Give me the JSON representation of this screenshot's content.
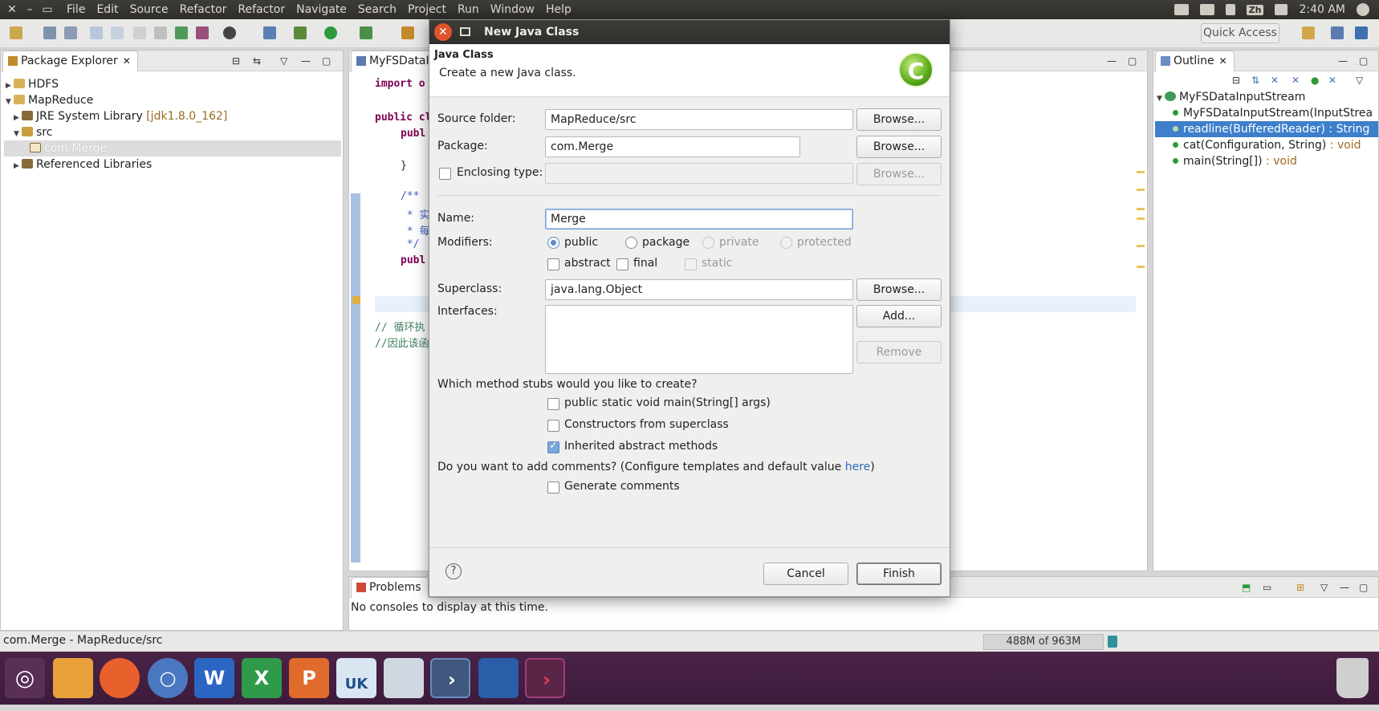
{
  "menubar": {
    "items": [
      "File",
      "Edit",
      "Source",
      "Refactor",
      "Refactor",
      "Navigate",
      "Search",
      "Project",
      "Run",
      "Window",
      "Help"
    ],
    "time": "2:40 AM",
    "input_method": "Zh"
  },
  "toolbar": {
    "quick_access": "Quick Access"
  },
  "package_explorer": {
    "tab": "Package Explorer",
    "tree": [
      {
        "label": "HDFS",
        "decoration": ""
      },
      {
        "label": "MapReduce",
        "decoration": ""
      },
      {
        "label": "JRE System Library",
        "decoration": "[jdk1.8.0_162]"
      },
      {
        "label": "src",
        "decoration": ""
      },
      {
        "label": "com.Merge",
        "decoration": ""
      },
      {
        "label": "Referenced Libraries",
        "decoration": ""
      }
    ]
  },
  "editor": {
    "tab": "MyFSDataI",
    "lines": [
      "import o",
      "public cl",
      "publ",
      "}",
      "/**",
      " * 实",
      " * 每",
      " */",
      "publ",
      "// 循环执",
      "//因此该函"
    ]
  },
  "outline": {
    "tab": "Outline",
    "items": [
      {
        "name": "MyFSDataInputStream",
        "ret": ""
      },
      {
        "name": "MyFSDataInputStream(InputStrea",
        "ret": ""
      },
      {
        "name": "readline(BufferedReader) : String",
        "ret": ""
      },
      {
        "name": "cat(Configuration, String)",
        "ret": " : void"
      },
      {
        "name": "main(String[])",
        "ret": " : void"
      }
    ]
  },
  "console": {
    "tab": "Problems",
    "message": "No consoles to display at this time."
  },
  "statusbar": {
    "left": "com.Merge - MapReduce/src",
    "heap": "488M of 963M"
  },
  "dialog": {
    "title": "New Java Class",
    "banner_title": "Java Class",
    "banner_desc": "Create a new Java class.",
    "source_folder_label": "Source folder:",
    "source_folder_value": "MapReduce/src",
    "package_label": "Package:",
    "package_value": "com.Merge",
    "enclosing_label": "Enclosing type:",
    "browse": "Browse...",
    "name_label": "Name:",
    "name_value": "Merge",
    "modifiers_label": "Modifiers:",
    "mod_public": "public",
    "mod_package": "package",
    "mod_private": "private",
    "mod_protected": "protected",
    "mod_abstract": "abstract",
    "mod_final": "final",
    "mod_static": "static",
    "superclass_label": "Superclass:",
    "superclass_value": "java.lang.Object",
    "interfaces_label": "Interfaces:",
    "add": "Add...",
    "remove": "Remove",
    "stubs_question": "Which method stubs would you like to create?",
    "stub_main": "public static void main(String[] args)",
    "stub_constructors": "Constructors from superclass",
    "stub_inherited": "Inherited abstract methods",
    "comments_question_pre": "Do you want to add comments? (Configure templates and default value ",
    "comments_link": "here",
    "comments_question_post": ")",
    "generate_comments": "Generate comments",
    "cancel": "Cancel",
    "finish": "Finish"
  },
  "dock": {
    "items": [
      "ubuntu",
      "files",
      "firefox",
      "chromium",
      "writer",
      "calc",
      "impress",
      "uk",
      "screenshot",
      "vscode",
      "apps",
      "terminal",
      "trash"
    ]
  }
}
